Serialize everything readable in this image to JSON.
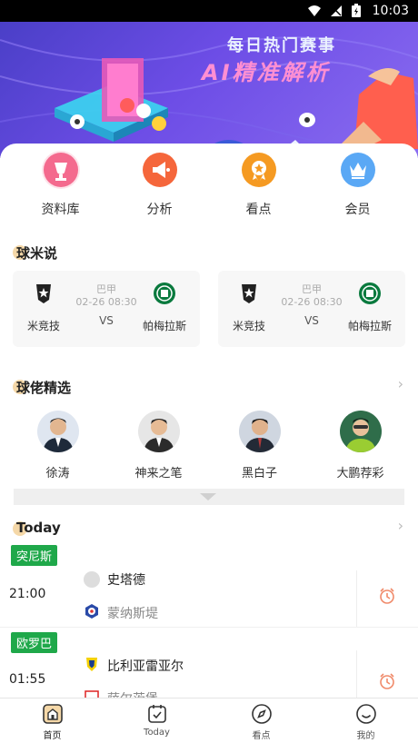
{
  "status_bar": {
    "time": "10:03"
  },
  "banner": {
    "line1": "每日热门赛事",
    "line2": "AI精准解析",
    "ai_mark": "AI"
  },
  "quick_actions": [
    {
      "label": "资料库",
      "icon": "database-icon",
      "color": "#f46a8e"
    },
    {
      "label": "分析",
      "icon": "megaphone-icon",
      "color": "#f5663b"
    },
    {
      "label": "看点",
      "icon": "medal-icon",
      "color": "#f59a22"
    },
    {
      "label": "会员",
      "icon": "crown-icon",
      "color": "#5aa8f5"
    }
  ],
  "section_qiumi": {
    "title": "球米说"
  },
  "match_cards": [
    {
      "home": "米竞技",
      "away": "帕梅拉斯",
      "league": "巴甲",
      "datetime": "02-26 08:30",
      "vs": "VS"
    },
    {
      "home": "米竞技",
      "away": "帕梅拉斯",
      "league": "巴甲",
      "datetime": "02-26 08:30",
      "vs": "VS"
    }
  ],
  "section_experts": {
    "title": "球佬精选"
  },
  "experts": [
    {
      "name": "徐涛"
    },
    {
      "name": "神来之笔"
    },
    {
      "name": "黑白子"
    },
    {
      "name": "大鹏荐彩"
    }
  ],
  "section_today": {
    "title": "Today"
  },
  "today_matches": [
    {
      "league": "突尼斯",
      "time": "21:00",
      "home": "史塔德",
      "away": "蒙纳斯堤"
    },
    {
      "league": "欧罗巴",
      "time": "01:55",
      "home": "比利亚雷亚尔",
      "away": "萨尔茨堡"
    }
  ],
  "tabbar": [
    {
      "label": "首页",
      "icon": "home-icon",
      "active": true
    },
    {
      "label": "Today",
      "icon": "calendar-icon",
      "active": false
    },
    {
      "label": "看点",
      "icon": "compass-icon",
      "active": false
    },
    {
      "label": "我的",
      "icon": "smiley-icon",
      "active": false
    }
  ],
  "colors": {
    "league_badge": "#1fa84a",
    "alarm": "#f08a6a",
    "accent_pink": "#ff8fd2"
  }
}
